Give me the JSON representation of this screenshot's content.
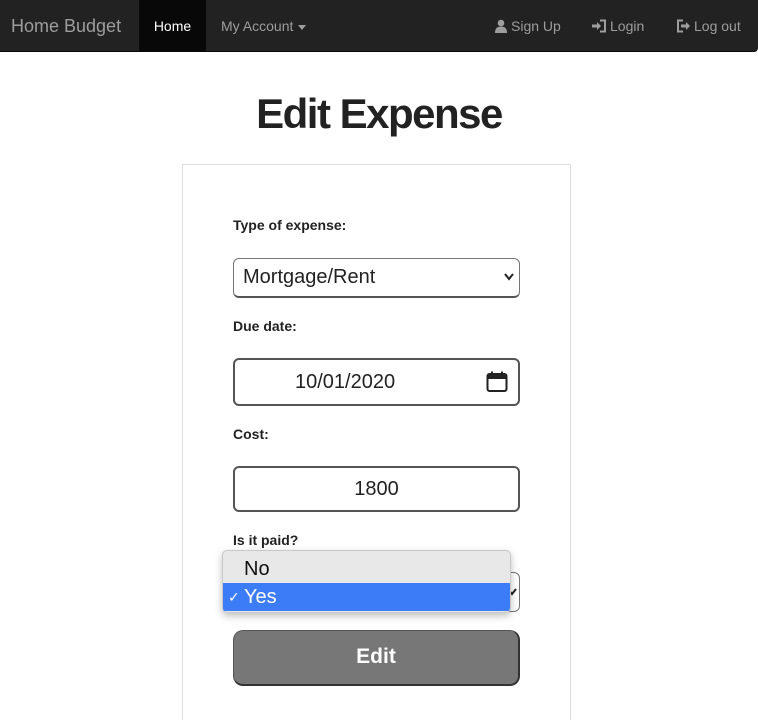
{
  "navbar": {
    "brand": "Home Budget",
    "home_label": "Home",
    "account_label": "My Account",
    "signup_label": "Sign Up",
    "login_label": "Login",
    "logout_label": "Log out"
  },
  "page": {
    "title": "Edit Expense"
  },
  "form": {
    "type_label": "Type of expense:",
    "type_value": "Mortgage/Rent",
    "due_label": "Due date:",
    "due_value": "10/01/2020",
    "cost_label": "Cost:",
    "cost_value": "1800",
    "paid_label": "Is it paid?",
    "paid_options": [
      "No",
      "Yes"
    ],
    "paid_selected": "Yes",
    "submit_label": "Edit"
  },
  "colors": {
    "navbar_bg": "#222222",
    "nav_active_bg": "#080808",
    "selected_option": "#3d7cf7",
    "button_bg": "#777777"
  }
}
